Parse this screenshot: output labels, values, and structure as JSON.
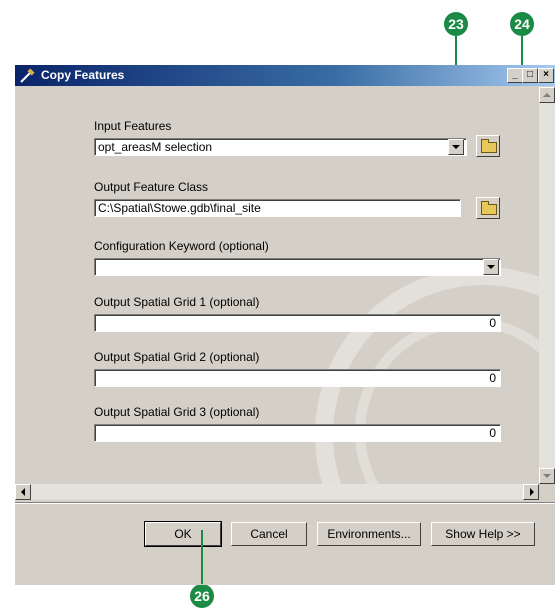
{
  "callouts": {
    "c23": "23",
    "c24": "24",
    "c26": "26"
  },
  "window": {
    "title": "Copy Features",
    "controls": {
      "minimize": "_",
      "maximize": "□",
      "close": "×"
    }
  },
  "form": {
    "input_features": {
      "label": "Input Features",
      "value": "opt_areasM selection"
    },
    "output_class": {
      "label": "Output Feature Class",
      "value": "C:\\Spatial\\Stowe.gdb\\final_site"
    },
    "config_keyword": {
      "label": "Configuration Keyword (optional)",
      "value": ""
    },
    "grid1": {
      "label": "Output Spatial Grid 1 (optional)",
      "value": "0"
    },
    "grid2": {
      "label": "Output Spatial Grid 2 (optional)",
      "value": "0"
    },
    "grid3": {
      "label": "Output Spatial Grid 3 (optional)",
      "value": "0"
    }
  },
  "buttons": {
    "ok": "OK",
    "cancel": "Cancel",
    "environments": "Environments...",
    "help": "Show Help >>"
  },
  "colors": {
    "callout": "#1b8a45",
    "titlebar_start": "#0a246a",
    "dialog_face": "#d4d0c8"
  }
}
